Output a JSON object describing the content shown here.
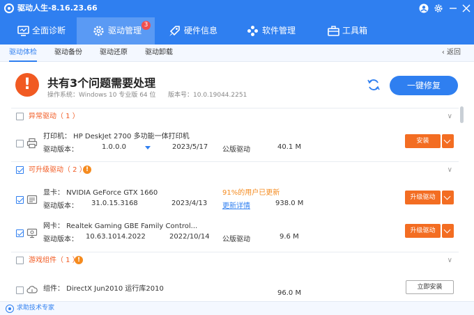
{
  "window": {
    "title": "驱动人生-8.16.23.66"
  },
  "nav": {
    "tabs": [
      {
        "label": "全面诊断"
      },
      {
        "label": "驱动管理",
        "badge": "3"
      },
      {
        "label": "硬件信息"
      },
      {
        "label": "软件管理"
      },
      {
        "label": "工具箱"
      }
    ]
  },
  "subnav": {
    "items": [
      {
        "label": "驱动体检"
      },
      {
        "label": "驱动备份"
      },
      {
        "label": "驱动还原"
      },
      {
        "label": "驱动卸载"
      }
    ],
    "back_label": "返回"
  },
  "summary": {
    "heading": "共有3个问题需要处理",
    "os_info": "操作系统：Windows 10 专业版 64 位",
    "version_info": "版本号：10.0.19044.2251",
    "fix_all_label": "一键修复"
  },
  "groups": [
    {
      "title": "异常驱动（ 1 ）"
    },
    {
      "title": "可升级驱动（ 2 ）"
    },
    {
      "title": "游戏组件（ 1 ）"
    }
  ],
  "items": [
    {
      "name": "打印机：  HP DeskJet 2700 多功能一体打印机",
      "version_label": "驱动版本：",
      "version": "1.0.0.0",
      "date": "2023/5/17",
      "kind": "公版驱动",
      "size": "40.1 M",
      "action": "安装",
      "icon": "printer-icon"
    },
    {
      "name": "显卡：  NVIDIA GeForce GTX 1660",
      "version_label": "驱动版本：",
      "version": "31.0.15.3168",
      "date": "2023/4/13",
      "users_note": "91%的用户已更新",
      "detail_link": "更新详情",
      "size": "938.0 M",
      "action": "升级驱动",
      "icon": "gpu-icon"
    },
    {
      "name": "网卡：  Realtek Gaming GBE Family Control...",
      "version_label": "驱动版本：",
      "version": "10.63.1014.2022",
      "date": "2022/10/14",
      "kind": "公版驱动",
      "size": "9.6 M",
      "action": "升级驱动",
      "icon": "network-card-icon"
    },
    {
      "name": "组件：  DirectX Jun2010 运行库2010",
      "size": "96.0 M",
      "action": "立即安装",
      "icon": "cloud-icon"
    }
  ],
  "footer": {
    "label": "求助技术专家"
  },
  "colors": {
    "primary": "#2f7ff0",
    "warning": "#f15a22",
    "action": "#f36d22"
  }
}
